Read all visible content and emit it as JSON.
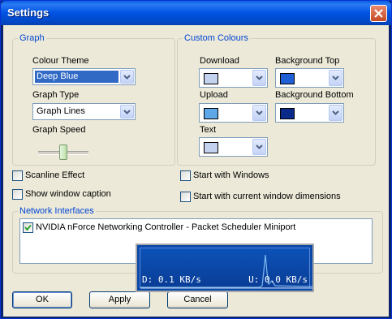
{
  "window": {
    "title": "Settings"
  },
  "graph_group": {
    "legend": "Graph",
    "colour_theme_label": "Colour Theme",
    "colour_theme_value": "Deep Blue",
    "graph_type_label": "Graph Type",
    "graph_type_value": "Graph Lines",
    "graph_speed_label": "Graph Speed"
  },
  "colours_group": {
    "legend": "Custom Colours",
    "download_label": "Download",
    "upload_label": "Upload",
    "text_label": "Text",
    "background_top_label": "Background Top",
    "background_bottom_label": "Background Bottom",
    "swatches": {
      "download": "#c3d3ef",
      "upload": "#5fa8e8",
      "text": "#c3d3ef",
      "background_top": "#1f5fd5",
      "background_bottom": "#0a2a8a"
    }
  },
  "options": {
    "scanline_effect": {
      "label": "Scanline Effect",
      "checked": false
    },
    "show_window_caption": {
      "label": "Show window caption",
      "checked": false
    },
    "start_with_windows": {
      "label": "Start with Windows",
      "checked": false
    },
    "start_with_dimensions": {
      "label": "Start with current window dimensions",
      "checked": false
    }
  },
  "network": {
    "legend": "Network Interfaces",
    "items": [
      {
        "label": "NVIDIA nForce Networking Controller - Packet Scheduler Miniport",
        "checked": true
      }
    ]
  },
  "mini_graph": {
    "download_readout": "D: 0.1 KB/s",
    "upload_readout": "U: 0.0 KB/s"
  },
  "buttons": {
    "ok": "OK",
    "apply": "Apply",
    "cancel": "Cancel"
  },
  "icons": {
    "close": "close-x-icon",
    "dropdown": "chevron-down-icon",
    "check": "checkmark-icon"
  }
}
